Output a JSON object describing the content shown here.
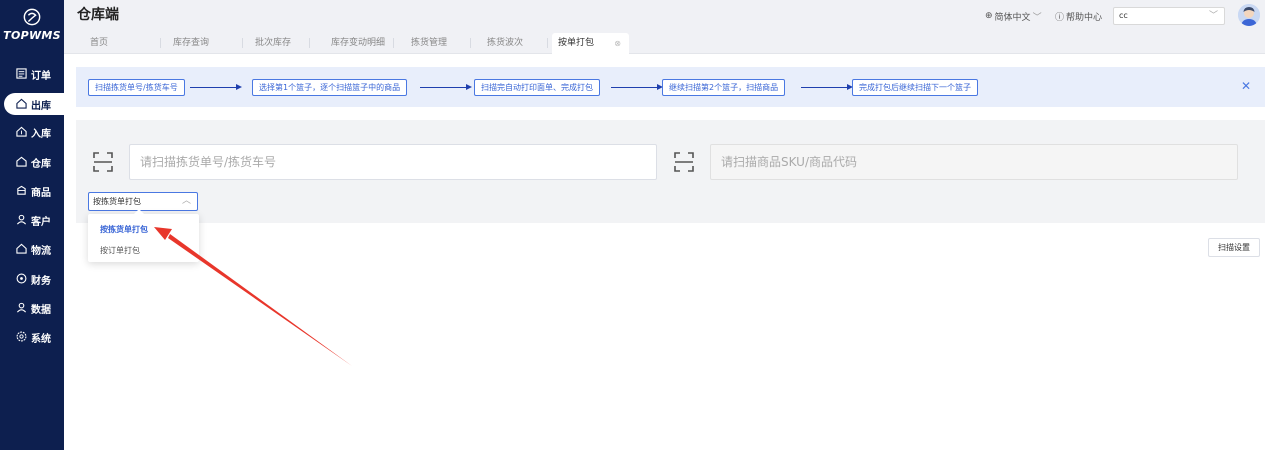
{
  "sidebar": {
    "logo_text": "TOPWMS",
    "items": [
      {
        "label": "订单",
        "icon": "list-icon"
      },
      {
        "label": "出库",
        "icon": "outbound-icon"
      },
      {
        "label": "入库",
        "icon": "inbound-icon"
      },
      {
        "label": "仓库",
        "icon": "warehouse-icon"
      },
      {
        "label": "商品",
        "icon": "product-icon"
      },
      {
        "label": "客户",
        "icon": "customer-icon"
      },
      {
        "label": "物流",
        "icon": "logistics-icon"
      },
      {
        "label": "财务",
        "icon": "finance-icon"
      },
      {
        "label": "数据",
        "icon": "data-icon"
      },
      {
        "label": "系统",
        "icon": "settings-icon"
      }
    ],
    "active_index": 1
  },
  "header": {
    "title": "仓库端",
    "language": "简体中文",
    "help": "帮助中心",
    "user": "cc",
    "tabs": [
      {
        "label": "首页"
      },
      {
        "label": "库存查询"
      },
      {
        "label": "批次库存"
      },
      {
        "label": "库存变动明细"
      },
      {
        "label": "拣货管理"
      },
      {
        "label": "拣货波次"
      },
      {
        "label": "按单打包"
      }
    ],
    "active_tab": 6
  },
  "steps": [
    "扫描拣货单号/拣货车号",
    "选择第1个篮子，逐个扫描篮子中的商品",
    "扫描完自动打印面单、完成打包",
    "继续扫描第2个篮子，扫描商品",
    "完成打包后继续扫描下一个篮子"
  ],
  "scan": {
    "pick_placeholder": "请扫描拣货单号/拣货车号",
    "sku_placeholder": "请扫描商品SKU/商品代码",
    "mode_value": "按拣货单打包",
    "mode_options": [
      "按拣货单打包",
      "按订单打包"
    ],
    "settings_label": "扫描设置"
  },
  "colors": {
    "sidebar_bg": "#0d1f4f",
    "accent": "#4a78e2",
    "annotation_arrow": "#e8362b"
  }
}
